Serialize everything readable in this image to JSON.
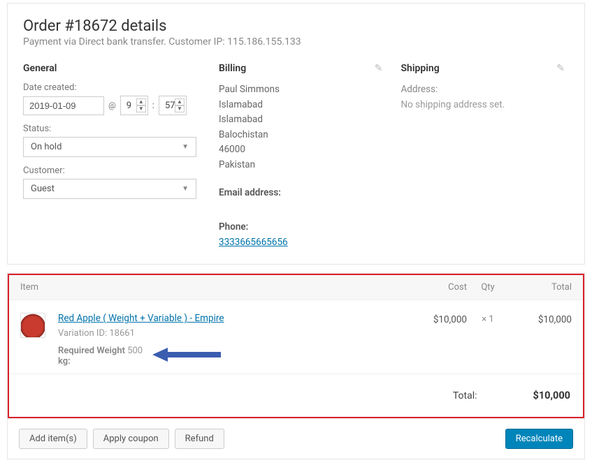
{
  "header": {
    "title": "Order #18672 details",
    "subtitle": "Payment via Direct bank transfer. Customer IP: 115.186.155.133"
  },
  "general": {
    "heading": "General",
    "date_label": "Date created:",
    "date_value": "2019-01-09",
    "at": "@",
    "hour": "9",
    "minute": "57",
    "status_label": "Status:",
    "status_value": "On hold",
    "customer_label": "Customer:",
    "customer_value": "Guest"
  },
  "billing": {
    "heading": "Billing",
    "name": "Paul Simmons",
    "city1": "Islamabad",
    "city2": "Islamabad",
    "state": "Balochistan",
    "postcode": "46000",
    "country": "Pakistan",
    "email_label": "Email address:",
    "phone_label": "Phone:",
    "phone": "3333665665656"
  },
  "shipping": {
    "heading": "Shipping",
    "addr_label": "Address:",
    "addr_empty": "No shipping address set."
  },
  "items": {
    "head_item": "Item",
    "head_cost": "Cost",
    "head_qty": "Qty",
    "head_total": "Total",
    "rows": [
      {
        "name": "Red Apple ( Weight + Variable ) - Empire",
        "variation_label": "Variation ID: 18661",
        "req_label": "Required Weight kg:",
        "req_value": "500",
        "cost": "$10,000",
        "qty": "× 1",
        "total": "$10,000"
      }
    ],
    "total_label": "Total:",
    "total_value": "$10,000"
  },
  "footer": {
    "add_items": "Add item(s)",
    "apply_coupon": "Apply coupon",
    "refund": "Refund",
    "recalculate": "Recalculate"
  }
}
